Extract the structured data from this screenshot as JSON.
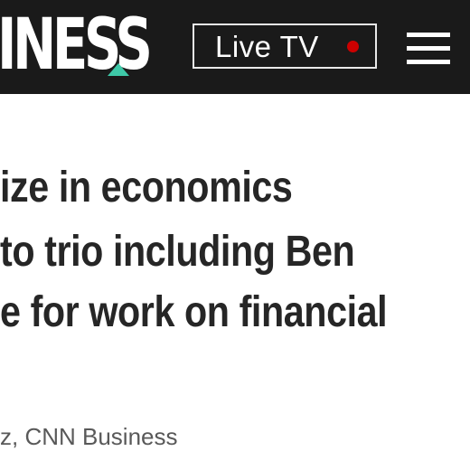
{
  "header": {
    "logo_text": "INESS",
    "live_tv_label": "Live TV",
    "colors": {
      "background": "#1a1a1a",
      "accent_triangle": "#3ec9a8",
      "live_dot": "#cc0000"
    },
    "menu_icon": "hamburger-menu-icon"
  },
  "article": {
    "headline_lines": [
      "ize in economics",
      " to trio including Ben",
      "e for work on financial"
    ],
    "byline": "z, CNN Business"
  }
}
